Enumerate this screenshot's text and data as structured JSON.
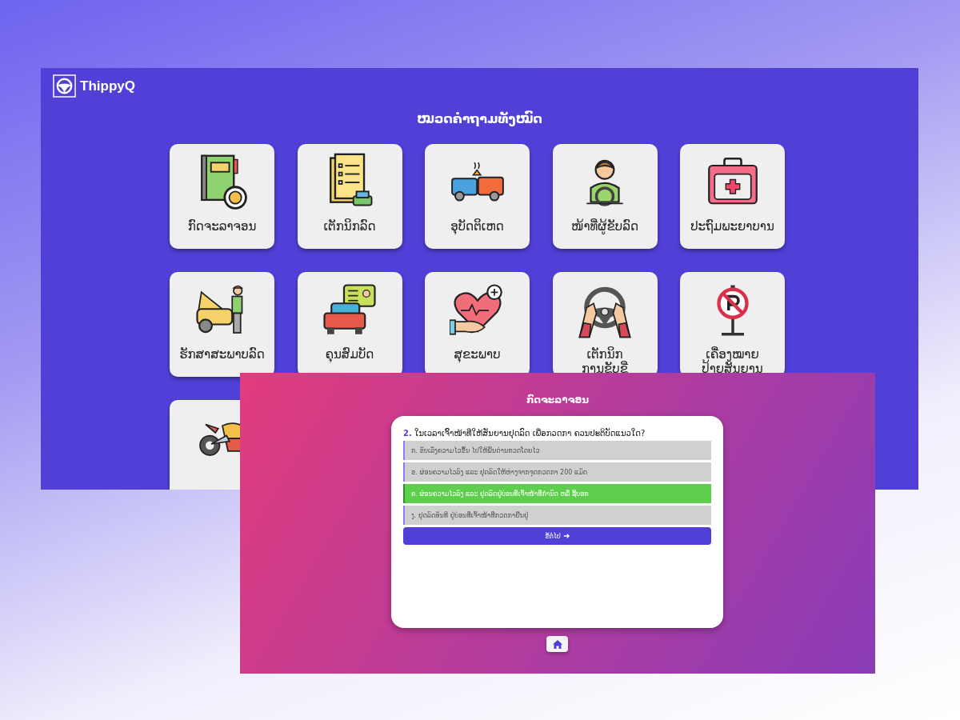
{
  "app": {
    "brand": "ThippyQ",
    "title": "ໝວດຄຳຖາມທັງໝົດ",
    "categories": [
      {
        "kind": "category",
        "label": [
          "ກົດຈະລາຈອນ"
        ]
      },
      {
        "kind": "category",
        "label": [
          "ເຕັກນິກລົດ"
        ]
      },
      {
        "kind": "category",
        "label": [
          "ອຸບັດຕິເຫດ"
        ]
      },
      {
        "kind": "category",
        "label": [
          "ໜ້າທີ່ຜູ້ຂັບລົດ"
        ]
      },
      {
        "kind": "category",
        "label": [
          "ປະຖົມພະຍາບານ"
        ]
      },
      {
        "kind": "category",
        "label": [
          "ຮັກສາສະພາບລົດ"
        ]
      },
      {
        "kind": "category",
        "label": [
          "ຄຸນສົມບັດ"
        ]
      },
      {
        "kind": "category",
        "label": [
          "ສຸຂະພາບ"
        ]
      },
      {
        "kind": "category",
        "label": [
          "ເຕັກນິກ",
          "ການຂັບຂີ່"
        ]
      },
      {
        "kind": "category",
        "label": [
          "ເຄື່ອງໝາຍ",
          "ປ້າຍສັນຍານ"
        ]
      },
      {
        "kind": "category"
      }
    ]
  },
  "quiz": {
    "title": "ກົດຈະລາຈອນ",
    "number": "2.",
    "question": "ໃນເວລາເຈົ້າໜ້າທີ່ໃຫ້ສັນຍານຢຸດລົດ ເພື່ອກວດກາ ຄວນປະຕິບັດແນວໃດ?",
    "options": [
      {
        "text": "ກ. ຂັບເລັ່ງຄວາມໄວຂຶ້ນ ໄປໃຫ້ພົ້ນດ່ານກວດໂດຍໄວ",
        "selected": false
      },
      {
        "text": "ຂ. ຜ່ອນຄວາມໄວລົງ ແລະ ຢຸດລົດໃຫ້ຫ່າງຈາກຈຸດກວດກາ 200 ແມັດ",
        "selected": false
      },
      {
        "text": "ຄ. ຜ່ອນຄວາມໄວລົງ ແລະ ຢຸດລົດຢູ່ບ່ອນທີ່ເຈົ້າໜ້າທີ່ກຳນົດ ຫລື ຊີ້ບອກ",
        "selected": true
      },
      {
        "text": "ງ. ຢຸດລົດທັນທີ ຢູ່ບ່ອນທີ່ເຈົ້າໜ້າທີ່ກວດກາຢືນຢູ່",
        "selected": false
      }
    ],
    "next": "ຂໍ້ຕໍ່ໄປ"
  }
}
